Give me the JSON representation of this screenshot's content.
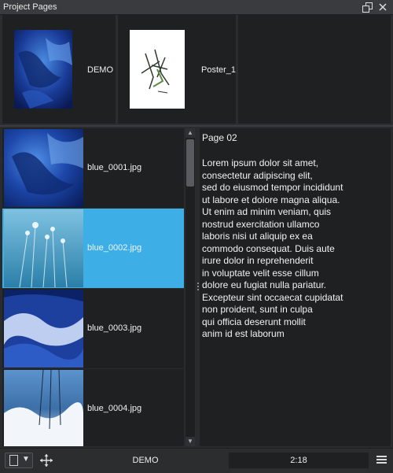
{
  "panel": {
    "title": "Project Pages"
  },
  "projects": [
    {
      "label": "DEMO"
    },
    {
      "label": "Poster_1"
    }
  ],
  "list": {
    "items": [
      {
        "name": "blue_0001.jpg",
        "selected": false
      },
      {
        "name": "blue_0002.jpg",
        "selected": true
      },
      {
        "name": "blue_0003.jpg",
        "selected": false
      },
      {
        "name": "blue_0004.jpg",
        "selected": false
      }
    ]
  },
  "detail": {
    "title": "Page 02",
    "body": "Lorem ipsum dolor sit amet,\nconsectetur adipiscing elit,\nsed do eiusmod tempor incididunt\nut labore et dolore magna aliqua.\nUt enim ad minim veniam, quis\nnostrud exercitation ullamco\nlaboris nisi ut aliquip ex ea\ncommodo consequat. Duis aute\nirure dolor in reprehenderit\nin voluptate velit esse cillum\ndolore eu fugiat nulla pariatur.\nExcepteur sint occaecat cupidatat\nnon proident, sunt in culpa\nqui officia deserunt mollit\nanim id est laborum"
  },
  "bottombar": {
    "project": "DEMO",
    "time": "2:18"
  },
  "colors": {
    "selection": "#3eaee6",
    "panel": "#1f2022"
  }
}
